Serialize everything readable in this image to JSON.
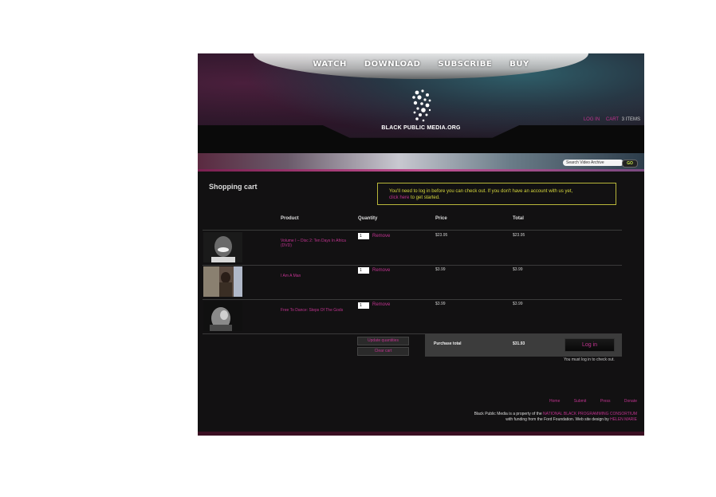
{
  "header": {
    "nav": [
      "WATCH",
      "DOWNLOAD",
      "SUBSCRIBE",
      "BUY"
    ],
    "logo_text": "BLACK PUBLIC MEDIA.ORG",
    "login_link": "LOG IN",
    "cart_link": "CART",
    "cart_count": "3 ITEMS"
  },
  "search": {
    "placeholder": "Search Video Archive",
    "go_label": "GO"
  },
  "page": {
    "title": "Shopping cart",
    "notice_text": "You'll need to log in before you can check out. If you don't have an account with us yet,",
    "notice_link": "click here",
    "notice_tail": "to get started."
  },
  "table": {
    "headers": [
      "Product",
      "Quantity",
      "Price",
      "Total"
    ],
    "rows": [
      {
        "product": "Volume I – Disc 2: Ten Days In Africa (DVD)",
        "qty": "1",
        "remove": "Remove",
        "price": "$23.95",
        "total": "$23.95",
        "thumb": "portrait-smiling-child"
      },
      {
        "product": "I Am A Man",
        "qty": "1",
        "remove": "Remove",
        "price": "$3.99",
        "total": "$3.99",
        "thumb": "portrait-man"
      },
      {
        "product": "Free To Dance: Steps Of The Gods",
        "qty": "1",
        "remove": "Remove",
        "price": "$3.99",
        "total": "$3.99",
        "thumb": "dancer-photo"
      }
    ]
  },
  "actions": {
    "update_label": "Update quantities",
    "clear_label": "Clear cart"
  },
  "summary": {
    "label": "Purchase total",
    "value": "$31.93",
    "login_label": "Log in",
    "note": "You must log in to check out."
  },
  "footer": {
    "links": [
      "Home",
      "Submit",
      "Press",
      "Donate"
    ],
    "line1_text": "Black Public Media is a property of the",
    "line1_link": "NATIONAL BLACK PROGRAMMING CONSORTIUM",
    "line2_text": "with funding from the Ford Foundation. Web site design by",
    "line2_link": "HELEN MARIE"
  },
  "colors": {
    "accent": "#c0338f",
    "notice": "#d7d83c",
    "background": "#121112"
  }
}
